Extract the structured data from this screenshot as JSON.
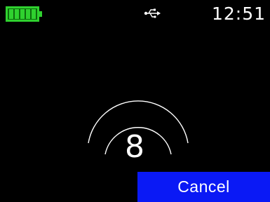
{
  "status_bar": {
    "battery_icon": "battery-full-icon",
    "battery_level": 1.0,
    "battery_color": "#2fd12f",
    "usb_icon": "usb-icon",
    "time": "12:51"
  },
  "main": {
    "indicator_icon": "signal-waves-icon",
    "digit": "8"
  },
  "actions": {
    "cancel_label": "Cancel",
    "cancel_color": "#0a19f5"
  }
}
